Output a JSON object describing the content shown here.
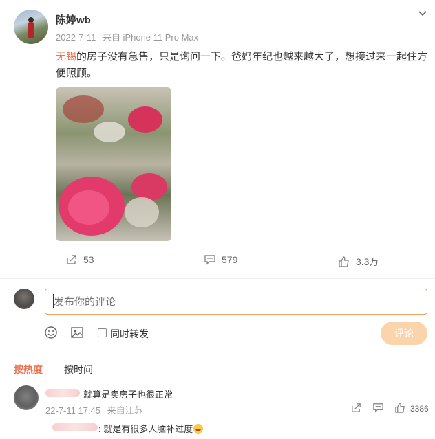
{
  "post": {
    "author": "陈婷wb",
    "date": "2022-7-11",
    "source": "来自 iPhone 11 Pro Max",
    "text_link": "无锡",
    "text_rest": "的房子没有急售，只是询问一下。爸妈年纪也越来越大了，想接过来一起住方便照顾。",
    "stats": {
      "reposts": "53",
      "comments": "579",
      "likes": "3.3万"
    }
  },
  "composer": {
    "placeholder": "发布你的评论",
    "repost_label": "同时转发",
    "submit_label": "评论"
  },
  "sort": {
    "hot": "按热度",
    "time": "按时间"
  },
  "comments": [
    {
      "text": "就算是卖房子也很正常",
      "date": "22-7-11 17:45",
      "location": "来自江苏",
      "likes": "3386",
      "reply": ":  就是有很多人脑补过度"
    }
  ],
  "colors": {
    "accent": "#eb7350",
    "input_border": "#f3a25a",
    "submit_bg": "#fbd4ac"
  }
}
